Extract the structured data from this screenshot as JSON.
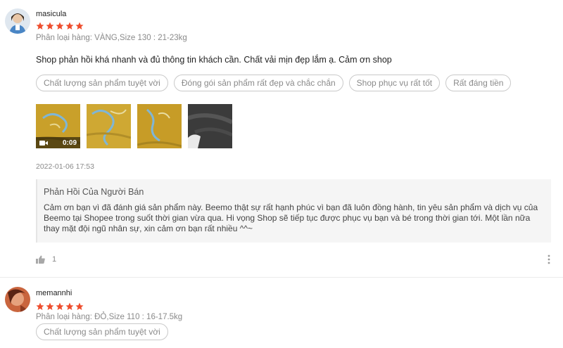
{
  "reviews": [
    {
      "username": "masicula",
      "rating": 5,
      "variation": "Phân loại hàng: VÀNG,Size 130 : 21-23kg",
      "comment": "Shop phản hồi khá nhanh và đủ thông tin khách cần. Chất vải mịn đẹp lắm ạ. Cảm ơn shop",
      "tags": [
        "Chất lượng sản phẩm tuyệt vời",
        "Đóng gói sản phẩm rất đẹp và chắc chắn",
        "Shop phục vụ rất tốt",
        "Rất đáng tiền"
      ],
      "video_duration": "0:09",
      "timestamp": "2022-01-06 17:53",
      "seller_reply": {
        "title": "Phản Hồi Của Người Bán",
        "text": "Cảm ơn bạn vì đã đánh giá sản phẩm này. Beemo thật sự rất hạnh phúc vì bạn đã luôn đồng hành, tin yêu sản phẩm và dịch vụ của Beemo tại Shopee trong suốt thời gian vừa qua. Hi vọng Shop sẽ tiếp tục được phục vụ bạn và bé trong thời gian tới. Một lần nữa thay mặt đội ngũ nhân sự, xin cảm ơn bạn rất nhiều ^^~"
      },
      "likes": "1"
    },
    {
      "username": "memannhi",
      "rating": 5,
      "variation": "Phân loại hàng: ĐỎ,Size 110 : 16-17.5kg",
      "tags": [
        "Chất lượng sản phẩm tuyệt vời"
      ]
    }
  ],
  "colors": {
    "star": "#ee4d2d",
    "tag_border": "#c9c9c9",
    "muted_text": "#8a8a8a",
    "reply_bg": "#f5f5f5"
  },
  "icons": {
    "like": "thumbs-up-icon",
    "more": "more-vertical-icon",
    "video": "video-camera-icon",
    "star": "star-icon"
  }
}
